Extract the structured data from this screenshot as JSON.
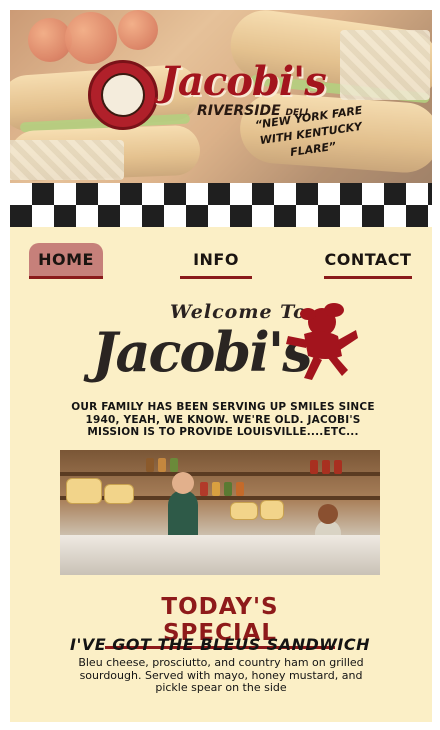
{
  "brand": {
    "name": "Jacobi's",
    "subtitle": "RIVERSIDE",
    "subtitle_small": "DELI",
    "tagline": "“NEW YORK FARE WITH KENTUCKY FLARE”"
  },
  "nav": {
    "items": [
      {
        "label": "HOME",
        "active": true
      },
      {
        "label": "INFO",
        "active": false
      },
      {
        "label": "CONTACT",
        "active": false
      }
    ]
  },
  "welcome": {
    "small": "Welcome To",
    "big": "Jacobi's",
    "intro": "OUR FAMILY HAS BEEN SERVING UP SMILES SINCE 1940, YEAH, WE KNOW. WE'RE OLD. JACOBI'S MISSION IS TO PROVIDE LOUISVILLE....ETC..."
  },
  "special": {
    "heading": "TODAY'S SPECIAL",
    "name": "I'VE GOT THE BLEUS SANDWICH",
    "description": "Bleu cheese, prosciutto, and country ham on grilled sourdough. Served with mayo, honey mustard, and pickle spear on the side"
  },
  "colors": {
    "background": "#fbefc6",
    "accent": "#8e1a1a",
    "nav_active": "#c6807a",
    "checker_dark": "#1f1f1f"
  },
  "icons": {
    "mascot": "running-mascot-icon",
    "logo": "chef-mascot-logo-icon"
  }
}
